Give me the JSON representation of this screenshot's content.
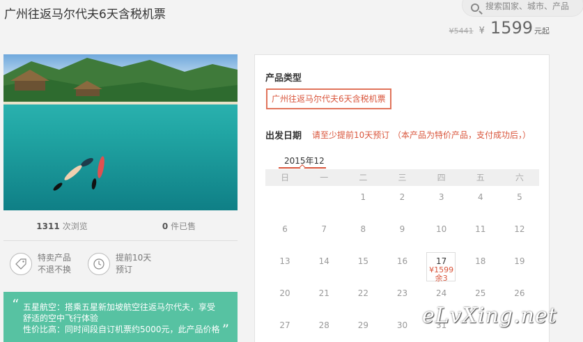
{
  "header": {
    "title": "广州往返马尔代夫6天含税机票",
    "search_placeholder": "搜索国家、城市、产品",
    "old_price": "¥5441",
    "currency": "¥",
    "price": "1599",
    "price_unit": "元起"
  },
  "stats": {
    "views_count": "1311",
    "views_label": "次浏览",
    "sold_count": "0",
    "sold_label": "件已售"
  },
  "features": [
    {
      "icon": "tag-icon",
      "line1": "特卖产品",
      "line2": "不退不换"
    },
    {
      "icon": "clock-icon",
      "line1": "提前10天",
      "line2": "预订"
    }
  ],
  "promo": {
    "line1": "五星航空：搭乘五星新加坡航空往返马尔代夫，享受",
    "line2": "舒适的空中飞行体验",
    "line3": "性价比高：同时间段自订机票约5000元，此产品价格"
  },
  "panel": {
    "product_type_label": "产品类型",
    "product_type_value": "广州往返马尔代夫6天含税机票",
    "depart_label": "出发日期",
    "depart_note1": "请至少提前10天预订",
    "depart_note2": "（本产品为特价产品，支付成功后，）",
    "month": "2015年12",
    "weekdays": [
      "日",
      "一",
      "二",
      "三",
      "四",
      "五",
      "六"
    ],
    "special_fare": "¥1599",
    "special_left": "余3"
  },
  "calendar": [
    [
      "",
      "",
      "1",
      "2",
      "3",
      "4",
      "5"
    ],
    [
      "6",
      "7",
      "8",
      "9",
      "10",
      "11",
      "12"
    ],
    [
      "13",
      "14",
      "15",
      "16",
      "17",
      "18",
      "19"
    ],
    [
      "20",
      "21",
      "22",
      "23",
      "24",
      "25",
      "26"
    ],
    [
      "27",
      "28",
      "29",
      "30",
      "31",
      "",
      ""
    ]
  ],
  "watermark": "eLvXing.net",
  "colors": {
    "accent": "#d9553b",
    "promo_bg": "#57c2a2"
  }
}
